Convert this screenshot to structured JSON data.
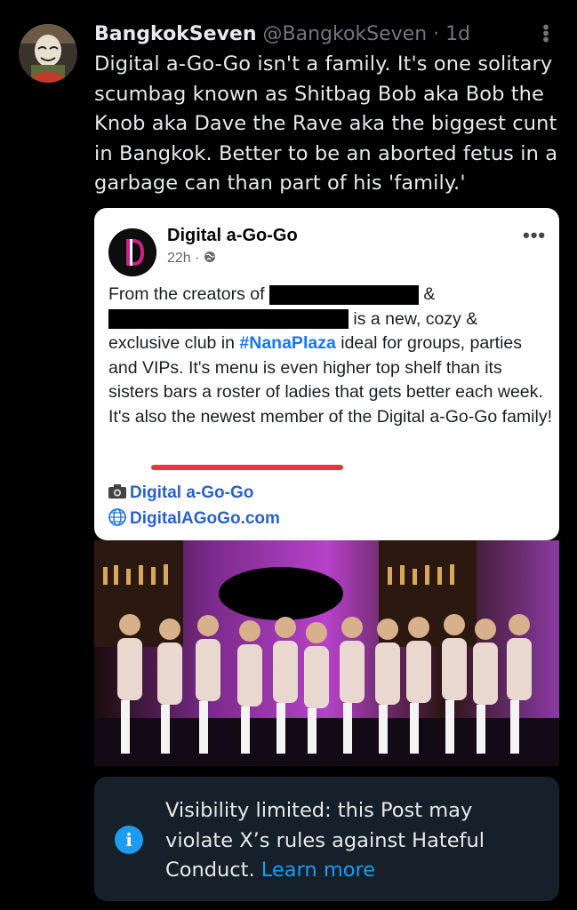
{
  "author": {
    "display_name": "BangkokSeven",
    "handle": "@BangkokSeven",
    "separator": "·",
    "time": "1d"
  },
  "tweet": {
    "text": "Digital a-Go-Go isn't a family. It's one solitary scumbag known as Shitbag Bob aka Bob the Knob aka Dave the Rave aka the biggest cunt in Bangkok. Better to be an aborted fetus in a garbage can than part of his 'family.'"
  },
  "embed": {
    "page_name": "Digital a-Go-Go",
    "time": "22h",
    "meta_separator": "·",
    "body_part1": "From the creators of",
    "body_amp": "&",
    "body_part2": "is a new, cozy &",
    "body_part3": "exclusive club in",
    "hashtag": "#NanaPlaza",
    "body_part4": "ideal for groups, parties and VIPs. It's menu is even higher top shelf than its sisters bars a roster of ladies that gets better each week. It's also the newest member of the Digital a-Go-Go family!",
    "link_instagram": "Digital a-Go-Go",
    "link_website": "DigitalAGoGo.com",
    "icons": [
      "camera-icon",
      "globe-icon"
    ]
  },
  "notice": {
    "text": "Visibility limited: this Post may violate X’s rules against Hateful Conduct.",
    "link": "Learn more"
  },
  "colors": {
    "background": "#000000",
    "accent": "#1d9bf0",
    "notice_bg": "#16202a",
    "fb_link": "#2a62c9",
    "underline": "#e53935"
  }
}
